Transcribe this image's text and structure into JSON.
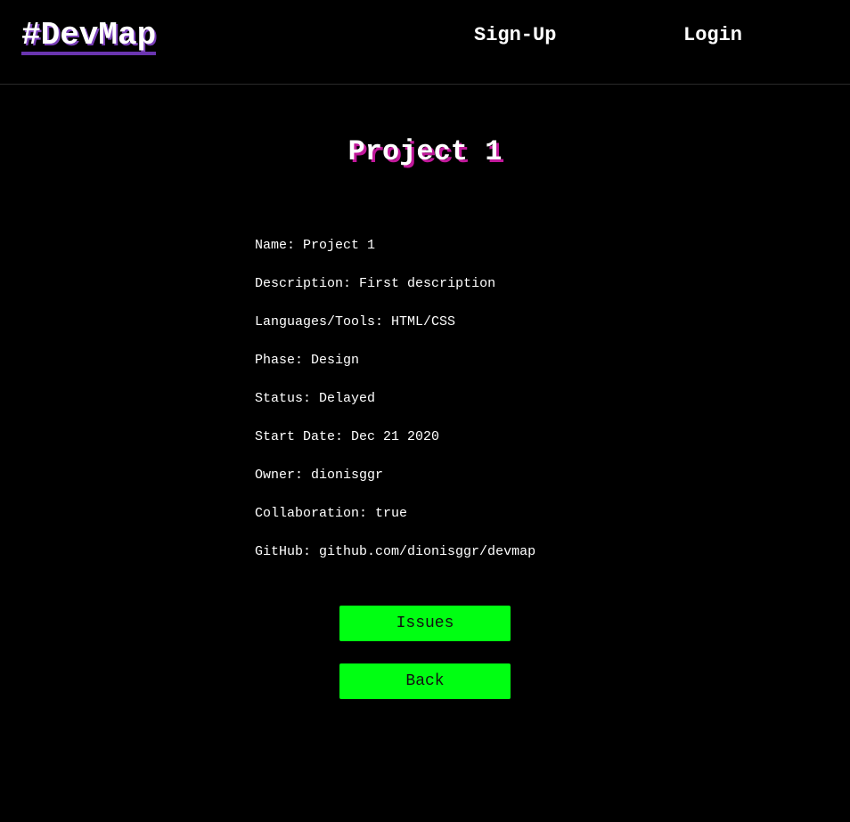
{
  "header": {
    "brand": "#DevMap",
    "signup_label": "Sign-Up",
    "login_label": "Login"
  },
  "project": {
    "title": "Project 1",
    "details": [
      {
        "label": "Name",
        "value": "Project 1"
      },
      {
        "label": "Description",
        "value": "First description"
      },
      {
        "label": "Languages/Tools",
        "value": "HTML/CSS"
      },
      {
        "label": "Phase",
        "value": "Design"
      },
      {
        "label": "Status",
        "value": "Delayed"
      },
      {
        "label": "Start Date",
        "value": "Dec 21 2020"
      },
      {
        "label": "Owner",
        "value": "dionisggr"
      },
      {
        "label": "Collaboration",
        "value": "true"
      },
      {
        "label": "GitHub",
        "value": "github.com/dionisggr/devmap"
      }
    ]
  },
  "actions": {
    "issues_label": "Issues",
    "back_label": "Back"
  },
  "colors": {
    "background": "#000000",
    "button": "#00ff12",
    "brand_underline": "#6a35b0",
    "title_shadow": "#c0189a"
  }
}
